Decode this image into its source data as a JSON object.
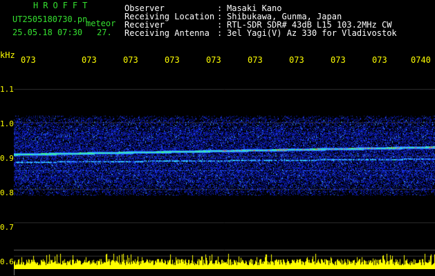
{
  "header": {
    "title": "HROFFT",
    "filename": "UT2505180730.pn",
    "tag": "meteor",
    "datetime": "25.05.18 07:30",
    "counter": "27."
  },
  "info": [
    {
      "key": "Observer",
      "value": "Masaki Kano"
    },
    {
      "key": "Receiving Location",
      "value": "Shibukawa, Gunma, Japan"
    },
    {
      "key": "Receiver",
      "value": "RTL-SDR SDR# 43dB L15 103.2MHz CW"
    },
    {
      "key": "Receiving Antenna",
      "value": "3el Yagi(V) Az 330 for Vladivostok"
    }
  ],
  "separator": ":",
  "axis": {
    "unit": "kHz",
    "freq_labels": [
      "1.1",
      "1.0",
      "0.9",
      "0.8",
      "0.7",
      "0.6"
    ],
    "time_labels": [
      "073",
      "073",
      "073",
      "073",
      "073",
      "073",
      "073",
      "073",
      "073",
      "0740"
    ]
  },
  "colors": {
    "header_title": "#35e030",
    "info_text": "#ffffff",
    "axis_labels": "#ffff00",
    "background": "#000000",
    "signal_low": "#1a2cff",
    "signal_mid": "#3fc6ff",
    "signal_high": "#ff3020",
    "bottom_bar": "#ffff00"
  }
}
